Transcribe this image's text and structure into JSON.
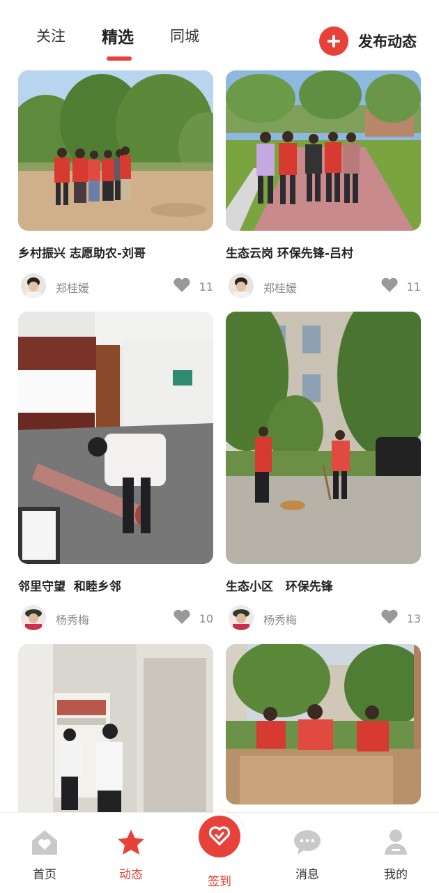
{
  "tabs": [
    {
      "label": "关注",
      "active": false
    },
    {
      "label": "精选",
      "active": true
    },
    {
      "label": "同城",
      "active": false
    }
  ],
  "publish_label": "发布动态",
  "accent_color": "#e8413a",
  "posts": [
    {
      "title": "乡村振兴 志愿助农-刘哥",
      "author": "郑桂媛",
      "likes": "11",
      "scene": "volunteers-in-orchard"
    },
    {
      "title": "生态云岗 环保先锋-吕村",
      "author": "郑桂媛",
      "likes": "11",
      "scene": "volunteers-on-park-path"
    },
    {
      "title": "邻里守望  和睦乡邻",
      "author": "杨秀梅",
      "likes": "10",
      "scene": "volunteer-rolling-carpet"
    },
    {
      "title": "生态小区   环保先锋",
      "author": "杨秀梅",
      "likes": "13",
      "scene": "volunteers-sweeping-courtyard"
    },
    {
      "scene": "volunteers-in-storeroom"
    },
    {
      "scene": "volunteers-at-table"
    }
  ],
  "nav": [
    {
      "label": "首页",
      "icon": "home-icon",
      "active": false
    },
    {
      "label": "动态",
      "icon": "star-icon",
      "active": true
    },
    {
      "label": "签到",
      "icon": "checkin-icon",
      "active": false
    },
    {
      "label": "消息",
      "icon": "message-icon",
      "active": false
    },
    {
      "label": "我的",
      "icon": "profile-icon",
      "active": false
    }
  ]
}
